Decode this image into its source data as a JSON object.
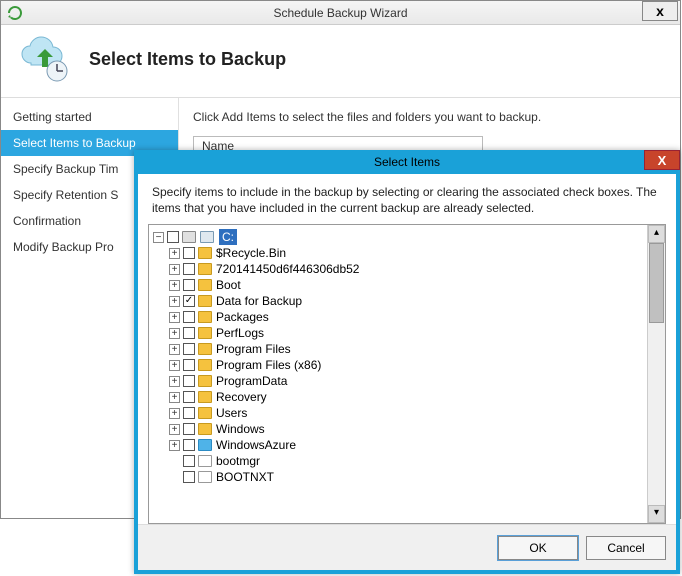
{
  "wizard": {
    "title": "Schedule Backup Wizard",
    "close_glyph": "x",
    "header": "Select Items to Backup",
    "nav": [
      {
        "label": "Getting started",
        "selected": false
      },
      {
        "label": "Select Items to Backup",
        "selected": true
      },
      {
        "label": "Specify Backup Tim",
        "selected": false
      },
      {
        "label": "Specify Retention S",
        "selected": false
      },
      {
        "label": "Confirmation",
        "selected": false
      },
      {
        "label": "Modify Backup Pro",
        "selected": false
      }
    ],
    "content_desc": "Click Add Items to select the files and folders you want to backup.",
    "name_col": "Name"
  },
  "modal": {
    "title": "Select Items",
    "close_glyph": "X",
    "message": "Specify items to include in the backup by selecting or clearing the associated check boxes. The items that you have included in the current backup are already selected.",
    "root_label": "C:",
    "tree": [
      {
        "expander": "+",
        "checked": false,
        "icon": "folder",
        "label": "$Recycle.Bin"
      },
      {
        "expander": "+",
        "checked": false,
        "icon": "folder",
        "label": "720141450d6f446306db52"
      },
      {
        "expander": "+",
        "checked": false,
        "icon": "folder",
        "label": "Boot"
      },
      {
        "expander": "+",
        "checked": true,
        "icon": "folder",
        "label": "Data for Backup"
      },
      {
        "expander": "+",
        "checked": false,
        "icon": "folder",
        "label": "Packages"
      },
      {
        "expander": "+",
        "checked": false,
        "icon": "folder",
        "label": "PerfLogs"
      },
      {
        "expander": "+",
        "checked": false,
        "icon": "folder",
        "label": "Program Files"
      },
      {
        "expander": "+",
        "checked": false,
        "icon": "folder",
        "label": "Program Files (x86)"
      },
      {
        "expander": "+",
        "checked": false,
        "icon": "folder",
        "label": "ProgramData"
      },
      {
        "expander": "+",
        "checked": false,
        "icon": "folder",
        "label": "Recovery"
      },
      {
        "expander": "+",
        "checked": false,
        "icon": "folder",
        "label": "Users"
      },
      {
        "expander": "+",
        "checked": false,
        "icon": "folder",
        "label": "Windows"
      },
      {
        "expander": "+",
        "checked": false,
        "icon": "azure",
        "label": "WindowsAzure"
      },
      {
        "expander": "",
        "checked": false,
        "icon": "file",
        "label": "bootmgr"
      },
      {
        "expander": "",
        "checked": false,
        "icon": "file",
        "label": "BOOTNXT"
      }
    ],
    "scroll": {
      "up": "▴",
      "down": "▾"
    },
    "buttons": {
      "ok": "OK",
      "cancel": "Cancel"
    }
  }
}
